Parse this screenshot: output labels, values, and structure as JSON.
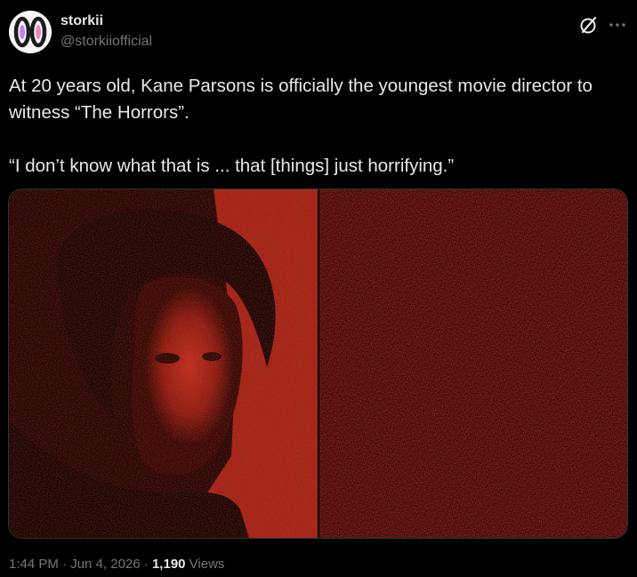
{
  "author": {
    "display_name": "storkii",
    "handle": "@storkiiofficial",
    "avatar_icon": "storkii-logo-avatar"
  },
  "actions": {
    "grok_icon": "grok-slash-icon",
    "more_icon": "more-dots-icon"
  },
  "tweet": {
    "paragraph_1": "At 20 years old, Kane Parsons is officially the youngest movie director to witness “The Horrors”.",
    "paragraph_2": "“I don’t know what that is ... that [things] just horrifying.”"
  },
  "media": {
    "left_image": "portrait-red-noise-image",
    "right_image": "red-noise-static-image"
  },
  "meta": {
    "time": "1:44 PM",
    "separator_1": " · ",
    "date": "Jun 4, 2026",
    "separator_2": " · ",
    "views_count": "1,190",
    "views_label": " Views"
  },
  "colors": {
    "background": "#000000",
    "text_primary": "#e7e9ea",
    "text_secondary": "#71767b",
    "border": "#2f3336",
    "media_red": "#b8261a"
  }
}
